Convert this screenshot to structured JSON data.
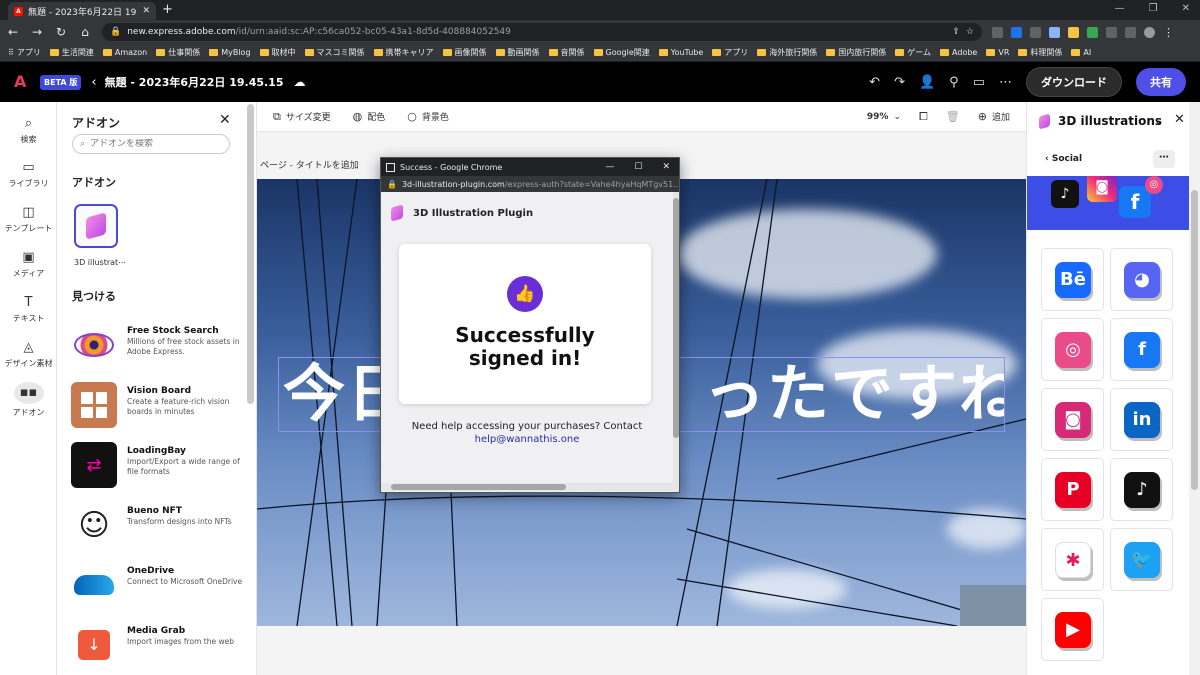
{
  "browser": {
    "tab_title": "無題 - 2023年6月22日 19.45.15",
    "url_host": "new.express.adobe.com",
    "url_path": "/id/urn:aaid:sc:AP:c56ca052-bc05-43a1-8d5d-408884052549",
    "bookmarks": [
      "アプリ",
      "生活関連",
      "Amazon",
      "仕事関係",
      "MyBlog",
      "取材中",
      "マスコミ関係",
      "携帯キャリア",
      "画像関係",
      "動画関係",
      "音関係",
      "Google関連",
      "YouTube",
      "アプリ",
      "海外旅行関係",
      "国内旅行関係",
      "ゲーム",
      "Adobe",
      "VR",
      "料理関係",
      "AI"
    ]
  },
  "header": {
    "beta_label": "BETA 版",
    "doc_title": "無題 - 2023年6月22日 19.45.15",
    "download_label": "ダウンロード",
    "share_label": "共有"
  },
  "rail": {
    "items": [
      {
        "label": "検索",
        "icon": "search-icon"
      },
      {
        "label": "ライブラリ",
        "icon": "folder-icon"
      },
      {
        "label": "テンプレート",
        "icon": "template-icon"
      },
      {
        "label": "メディア",
        "icon": "media-icon"
      },
      {
        "label": "テキスト",
        "icon": "text-icon"
      },
      {
        "label": "デザイン素材",
        "icon": "shapes-icon"
      },
      {
        "label": "アドオン",
        "icon": "addon-icon"
      }
    ]
  },
  "addon_panel": {
    "title": "アドオン",
    "search_placeholder": "アドオンを検索",
    "section_addons": "アドオン",
    "installed_label": "3D illustrat⋯",
    "section_find": "見つける",
    "items": [
      {
        "name": "Free Stock Search",
        "desc": "Millions of free stock assets in Adobe Express."
      },
      {
        "name": "Vision Board",
        "desc": "Create a feature-rich vision boards in minutes"
      },
      {
        "name": "LoadingBay",
        "desc": "Import/Export a wide range of file formats"
      },
      {
        "name": "Bueno NFT",
        "desc": "Transform designs into NFTs"
      },
      {
        "name": "OneDrive",
        "desc": "Connect to Microsoft OneDrive"
      },
      {
        "name": "Media Grab",
        "desc": "Import images from the web"
      }
    ]
  },
  "canvas_toolbar": {
    "resize": "サイズ変更",
    "palette": "配色",
    "background": "背景色",
    "zoom": "99%",
    "add": "追加"
  },
  "canvas": {
    "page_title_placeholder": "ページ - タイトルを追加",
    "text_left": "今日",
    "text_right": "ったですね"
  },
  "popup": {
    "window_title": "Success - Google Chrome",
    "url_host": "3d-illustration-plugin.com",
    "url_path": "/express-auth?state=Vahe4hyaHqMTgv51...",
    "plugin_name": "3D Illustration Plugin",
    "success_line1": "Successfully",
    "success_line2": "signed in!",
    "help_text": "Need help accessing your purchases? Contact",
    "help_email": "help@wannathis.one"
  },
  "right_panel": {
    "title": "3D illustrations",
    "back_label": "Social",
    "icons": [
      {
        "name": "behance",
        "glyph": "Bē",
        "color": "#1769ff"
      },
      {
        "name": "discord",
        "glyph": "◕",
        "color": "#5865f2"
      },
      {
        "name": "dribbble",
        "glyph": "◎",
        "color": "#ea4c89"
      },
      {
        "name": "facebook",
        "glyph": "f",
        "color": "#1877f2"
      },
      {
        "name": "instagram",
        "glyph": "◙",
        "color": "#d62976"
      },
      {
        "name": "linkedin",
        "glyph": "in",
        "color": "#0a66c2"
      },
      {
        "name": "pinterest",
        "glyph": "P",
        "color": "#e60023"
      },
      {
        "name": "tiktok",
        "glyph": "♪",
        "color": "#111111"
      },
      {
        "name": "slack",
        "glyph": "✱",
        "color": "#ffffff"
      },
      {
        "name": "twitter",
        "glyph": "🐦",
        "color": "#1da1f2"
      },
      {
        "name": "youtube",
        "glyph": "▶",
        "color": "#ff0000"
      }
    ]
  },
  "colors": {
    "accent": "#4f4fe8",
    "beta": "#3d4bd8",
    "thumb": "#6a2ed8"
  }
}
